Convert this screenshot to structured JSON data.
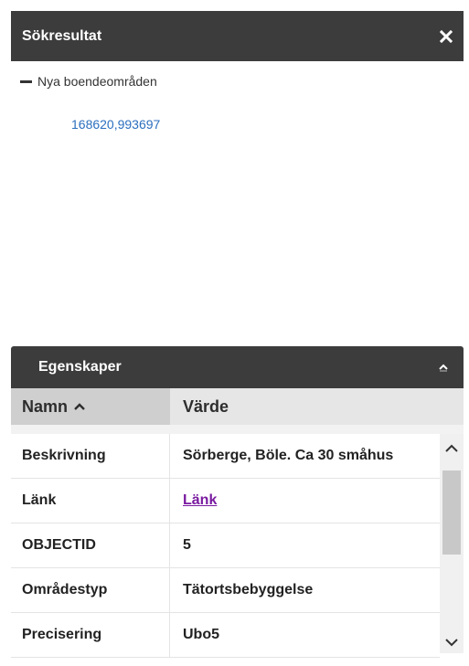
{
  "search_results": {
    "title": "Sökresultat",
    "close_icon": "close-icon",
    "group": {
      "label": "Nya boendeområden",
      "toggle_icon": "minus-icon"
    },
    "result_link": "168620,993697"
  },
  "properties": {
    "title": "Egenskaper",
    "toggle_icon": "chevron-up-icon",
    "columns": {
      "name": "Namn",
      "value": "Värde",
      "sort_icon": "chevron-up-icon"
    },
    "rows": [
      {
        "name": "Beskrivning",
        "value": "Sörberge, Böle. Ca 30 småhus"
      },
      {
        "name": "Länk",
        "value": "Länk"
      },
      {
        "name": "OBJECTID",
        "value": "5"
      },
      {
        "name": "Områdestyp",
        "value": "Tätortsbebyggelse"
      },
      {
        "name": "Precisering",
        "value": "Ubo5"
      }
    ]
  },
  "colors": {
    "header_bg": "#3c3c3c",
    "link_blue": "#2c6fbf",
    "link_purple": "#7a1aa0",
    "column_header_bg": "#e6e6e6"
  }
}
